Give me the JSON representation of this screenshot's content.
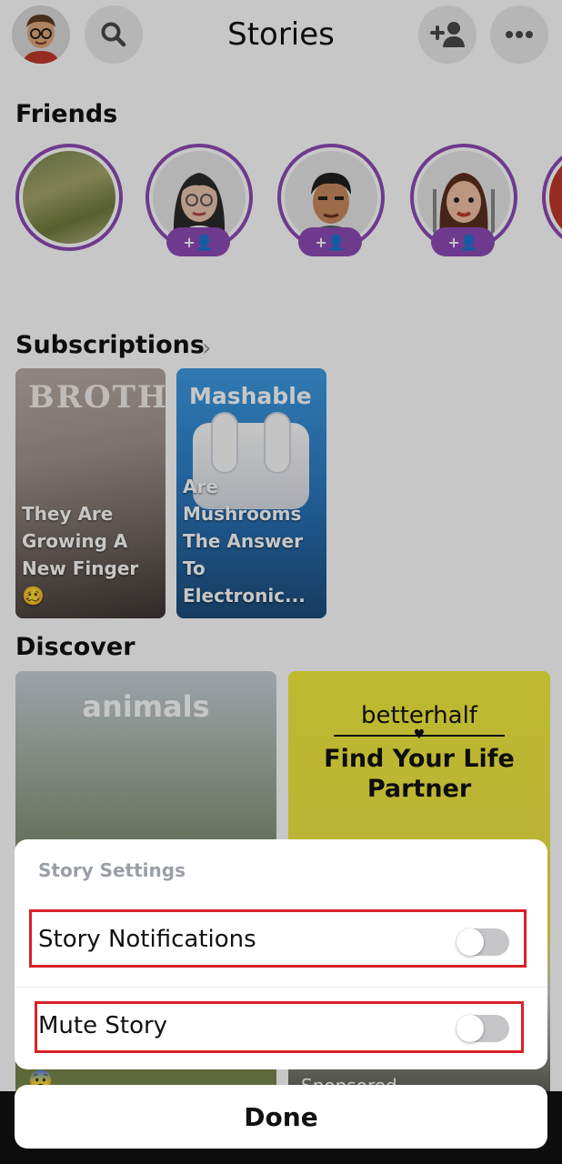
{
  "header": {
    "title": "Stories",
    "avatar_icon": "bitmoji-avatar-icon",
    "search_icon": "search-icon",
    "add_friend_icon": "add-friend-icon",
    "more_icon": "more-icon"
  },
  "friends": {
    "title": "Friends",
    "add_label": "+👤"
  },
  "subscriptions": {
    "title": "Subscriptions",
    "chevron": "›",
    "cards": [
      {
        "brand": "BROTHER",
        "caption": "They Are\nGrowing A\nNew Finger\n🥴"
      },
      {
        "brand": "Mashable",
        "caption": "Are\nMushrooms\nThe Answer\nTo Electronic..."
      }
    ]
  },
  "discover": {
    "title": "Discover",
    "cards": [
      {
        "brand": "animals",
        "footer_emoji": "😨"
      },
      {
        "brand": "betterhalf",
        "tagline": "Find Your Life Partner",
        "footer": "Sponsored"
      }
    ]
  },
  "sheet": {
    "title": "Story Settings",
    "rows": [
      {
        "label": "Story Notifications",
        "enabled": false
      },
      {
        "label": "Mute Story",
        "enabled": false
      }
    ],
    "done_label": "Done"
  },
  "colors": {
    "accent_purple": "#8d4bb5",
    "highlight_red": "#d8222a",
    "toggle_off": "#c6c6c8"
  }
}
